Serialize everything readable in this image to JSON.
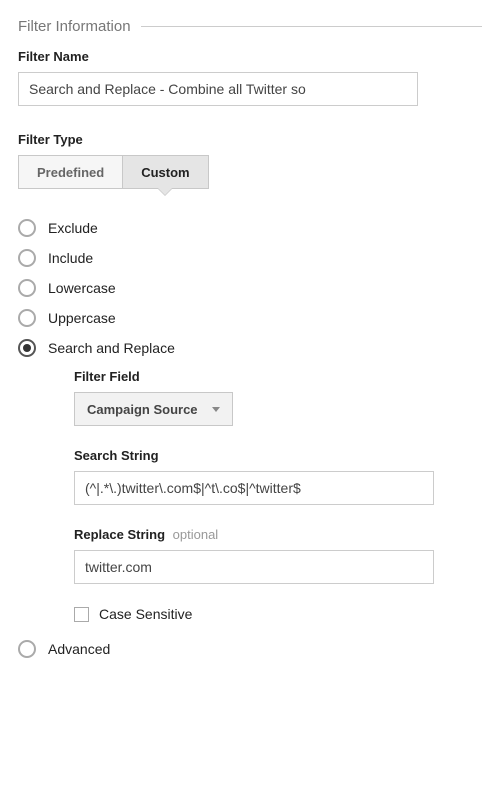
{
  "section": {
    "title": "Filter Information"
  },
  "filterName": {
    "label": "Filter Name",
    "value": "Search and Replace - Combine all Twitter so"
  },
  "filterType": {
    "label": "Filter Type",
    "options": [
      "Predefined",
      "Custom"
    ],
    "selected": "Custom"
  },
  "radios": {
    "exclude": "Exclude",
    "include": "Include",
    "lowercase": "Lowercase",
    "uppercase": "Uppercase",
    "searchReplace": "Search and Replace",
    "advanced": "Advanced",
    "selected": "searchReplace"
  },
  "searchReplace": {
    "filterField": {
      "label": "Filter Field",
      "value": "Campaign Source"
    },
    "searchString": {
      "label": "Search String",
      "value": "(^|.*\\.)twitter\\.com$|^t\\.co$|^twitter$"
    },
    "replaceString": {
      "label": "Replace String",
      "optional": "optional",
      "value": "twitter.com"
    },
    "caseSensitive": {
      "label": "Case Sensitive",
      "checked": false
    }
  }
}
